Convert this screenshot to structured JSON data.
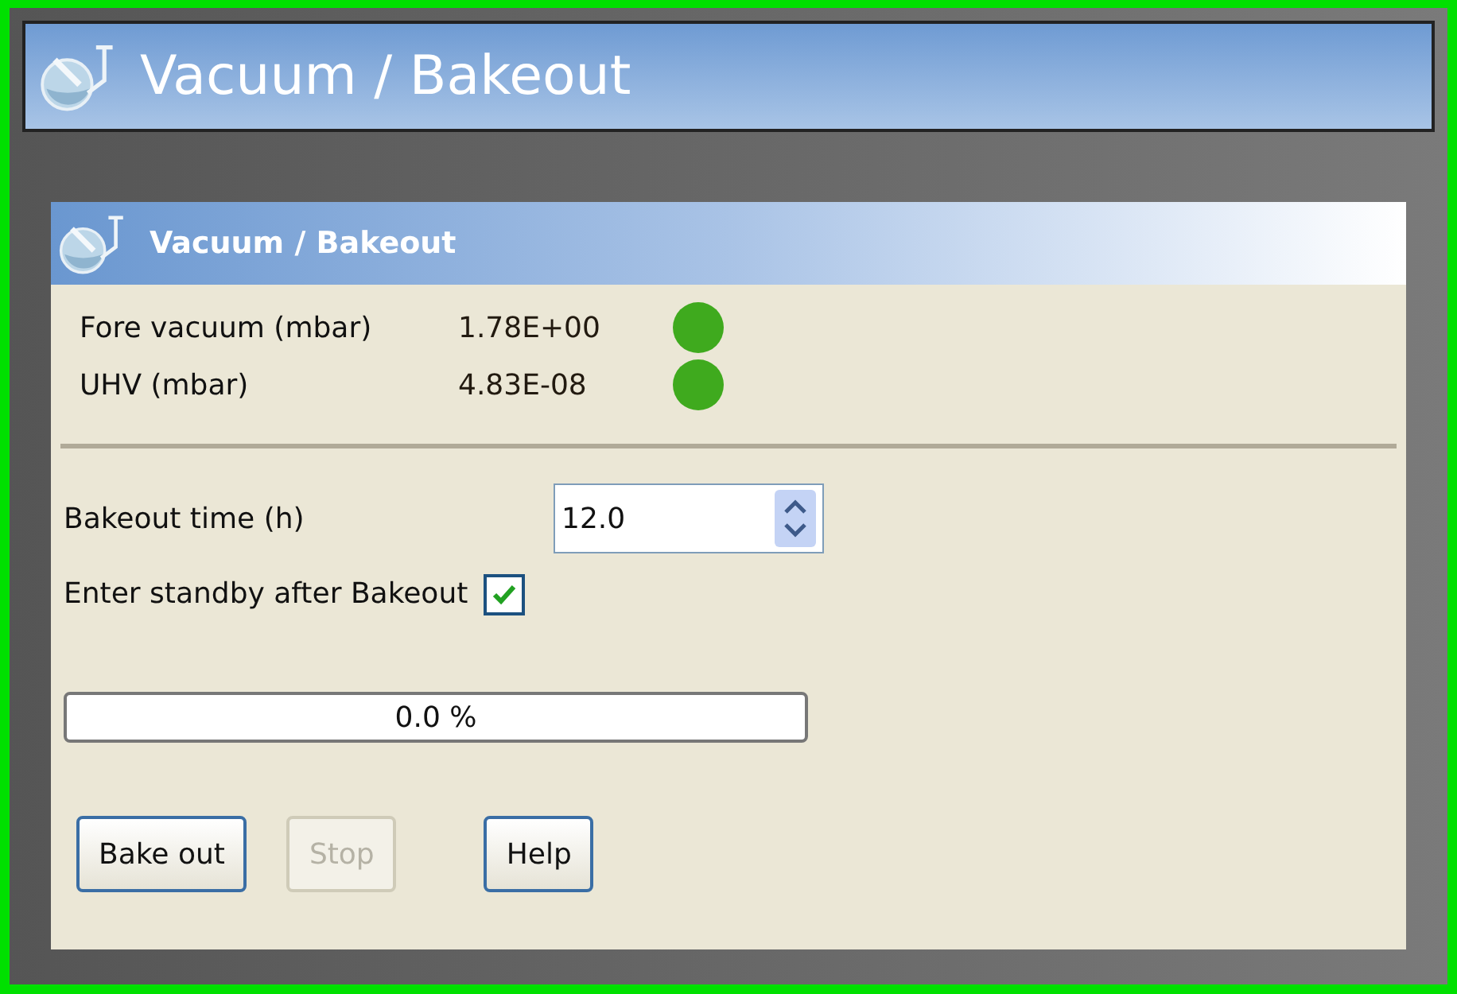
{
  "window": {
    "title": "Vacuum / Bakeout"
  },
  "panel": {
    "title": "Vacuum / Bakeout"
  },
  "readings": [
    {
      "label": "Fore vacuum (mbar)",
      "value": "1.78E+00",
      "color": "#3faa1e"
    },
    {
      "label": "UHV (mbar)",
      "value": "4.83E-08",
      "color": "#3faa1e"
    }
  ],
  "bakeout_time": {
    "label": "Bakeout time (h)",
    "value": "12.0"
  },
  "standby": {
    "label": "Enter standby after Bakeout",
    "checked": true
  },
  "progress": {
    "level": 0,
    "reading": "0.0 %"
  },
  "buttons": [
    {
      "label": "Bake out",
      "disabled": false
    },
    {
      "label": "Stop",
      "disabled": true
    },
    {
      "label": "Help",
      "disabled": false
    }
  ]
}
